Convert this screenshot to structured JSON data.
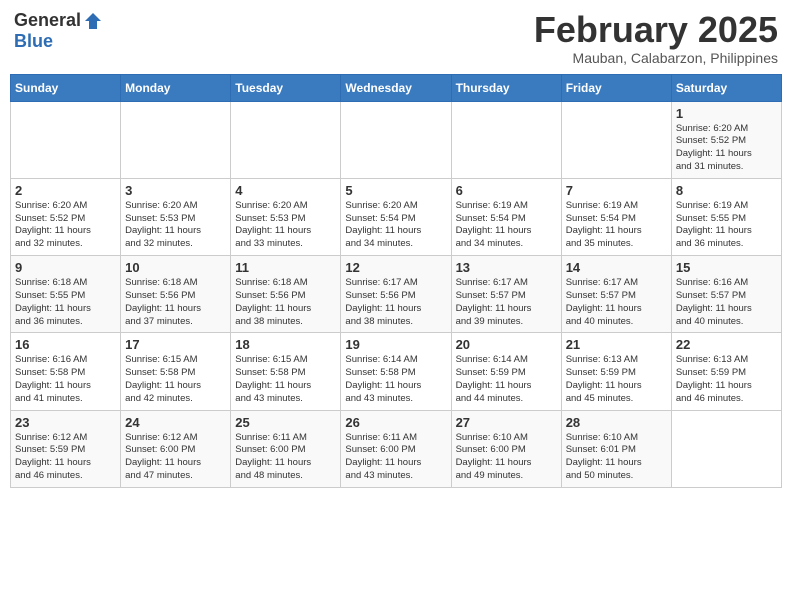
{
  "header": {
    "logo_general": "General",
    "logo_blue": "Blue",
    "month": "February 2025",
    "location": "Mauban, Calabarzon, Philippines"
  },
  "weekdays": [
    "Sunday",
    "Monday",
    "Tuesday",
    "Wednesday",
    "Thursday",
    "Friday",
    "Saturday"
  ],
  "weeks": [
    [
      {
        "day": "",
        "info": ""
      },
      {
        "day": "",
        "info": ""
      },
      {
        "day": "",
        "info": ""
      },
      {
        "day": "",
        "info": ""
      },
      {
        "day": "",
        "info": ""
      },
      {
        "day": "",
        "info": ""
      },
      {
        "day": "1",
        "info": "Sunrise: 6:20 AM\nSunset: 5:52 PM\nDaylight: 11 hours\nand 31 minutes."
      }
    ],
    [
      {
        "day": "2",
        "info": "Sunrise: 6:20 AM\nSunset: 5:52 PM\nDaylight: 11 hours\nand 32 minutes."
      },
      {
        "day": "3",
        "info": "Sunrise: 6:20 AM\nSunset: 5:53 PM\nDaylight: 11 hours\nand 32 minutes."
      },
      {
        "day": "4",
        "info": "Sunrise: 6:20 AM\nSunset: 5:53 PM\nDaylight: 11 hours\nand 33 minutes."
      },
      {
        "day": "5",
        "info": "Sunrise: 6:20 AM\nSunset: 5:54 PM\nDaylight: 11 hours\nand 34 minutes."
      },
      {
        "day": "6",
        "info": "Sunrise: 6:19 AM\nSunset: 5:54 PM\nDaylight: 11 hours\nand 34 minutes."
      },
      {
        "day": "7",
        "info": "Sunrise: 6:19 AM\nSunset: 5:54 PM\nDaylight: 11 hours\nand 35 minutes."
      },
      {
        "day": "8",
        "info": "Sunrise: 6:19 AM\nSunset: 5:55 PM\nDaylight: 11 hours\nand 36 minutes."
      }
    ],
    [
      {
        "day": "9",
        "info": "Sunrise: 6:18 AM\nSunset: 5:55 PM\nDaylight: 11 hours\nand 36 minutes."
      },
      {
        "day": "10",
        "info": "Sunrise: 6:18 AM\nSunset: 5:56 PM\nDaylight: 11 hours\nand 37 minutes."
      },
      {
        "day": "11",
        "info": "Sunrise: 6:18 AM\nSunset: 5:56 PM\nDaylight: 11 hours\nand 38 minutes."
      },
      {
        "day": "12",
        "info": "Sunrise: 6:17 AM\nSunset: 5:56 PM\nDaylight: 11 hours\nand 38 minutes."
      },
      {
        "day": "13",
        "info": "Sunrise: 6:17 AM\nSunset: 5:57 PM\nDaylight: 11 hours\nand 39 minutes."
      },
      {
        "day": "14",
        "info": "Sunrise: 6:17 AM\nSunset: 5:57 PM\nDaylight: 11 hours\nand 40 minutes."
      },
      {
        "day": "15",
        "info": "Sunrise: 6:16 AM\nSunset: 5:57 PM\nDaylight: 11 hours\nand 40 minutes."
      }
    ],
    [
      {
        "day": "16",
        "info": "Sunrise: 6:16 AM\nSunset: 5:58 PM\nDaylight: 11 hours\nand 41 minutes."
      },
      {
        "day": "17",
        "info": "Sunrise: 6:15 AM\nSunset: 5:58 PM\nDaylight: 11 hours\nand 42 minutes."
      },
      {
        "day": "18",
        "info": "Sunrise: 6:15 AM\nSunset: 5:58 PM\nDaylight: 11 hours\nand 43 minutes."
      },
      {
        "day": "19",
        "info": "Sunrise: 6:14 AM\nSunset: 5:58 PM\nDaylight: 11 hours\nand 43 minutes."
      },
      {
        "day": "20",
        "info": "Sunrise: 6:14 AM\nSunset: 5:59 PM\nDaylight: 11 hours\nand 44 minutes."
      },
      {
        "day": "21",
        "info": "Sunrise: 6:13 AM\nSunset: 5:59 PM\nDaylight: 11 hours\nand 45 minutes."
      },
      {
        "day": "22",
        "info": "Sunrise: 6:13 AM\nSunset: 5:59 PM\nDaylight: 11 hours\nand 46 minutes."
      }
    ],
    [
      {
        "day": "23",
        "info": "Sunrise: 6:12 AM\nSunset: 5:59 PM\nDaylight: 11 hours\nand 46 minutes."
      },
      {
        "day": "24",
        "info": "Sunrise: 6:12 AM\nSunset: 6:00 PM\nDaylight: 11 hours\nand 47 minutes."
      },
      {
        "day": "25",
        "info": "Sunrise: 6:11 AM\nSunset: 6:00 PM\nDaylight: 11 hours\nand 48 minutes."
      },
      {
        "day": "26",
        "info": "Sunrise: 6:11 AM\nSunset: 6:00 PM\nDaylight: 11 hours\nand 43 minutes."
      },
      {
        "day": "27",
        "info": "Sunrise: 6:10 AM\nSunset: 6:00 PM\nDaylight: 11 hours\nand 49 minutes."
      },
      {
        "day": "28",
        "info": "Sunrise: 6:10 AM\nSunset: 6:01 PM\nDaylight: 11 hours\nand 50 minutes."
      },
      {
        "day": "",
        "info": ""
      }
    ]
  ]
}
